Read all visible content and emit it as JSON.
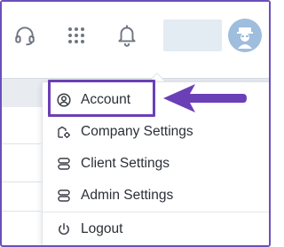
{
  "header": {
    "icons": [
      "headset-icon",
      "apps-grid-icon",
      "bell-icon"
    ],
    "accent_color": "#6b3fb6"
  },
  "menu": {
    "items": [
      {
        "label": "Account",
        "icon": "account-circle-icon"
      },
      {
        "label": "Company Settings",
        "icon": "company-settings-icon"
      },
      {
        "label": "Client Settings",
        "icon": "server-icon"
      },
      {
        "label": "Admin Settings",
        "icon": "server-icon"
      }
    ],
    "logout": {
      "label": "Logout",
      "icon": "power-icon"
    }
  }
}
